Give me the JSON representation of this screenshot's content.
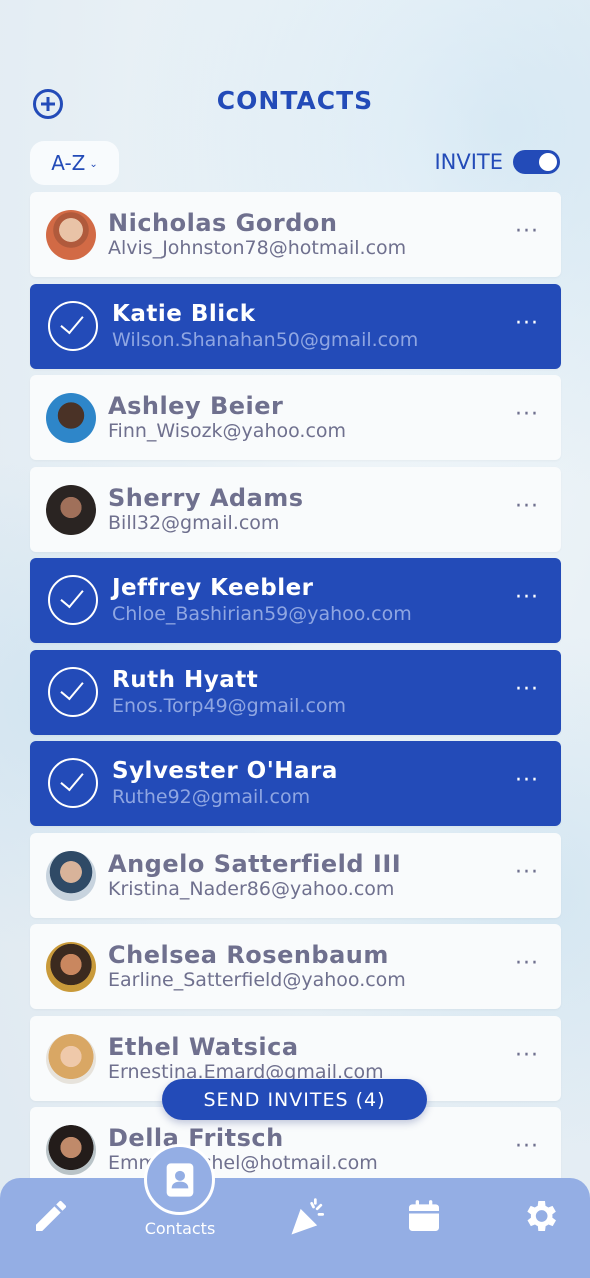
{
  "header": {
    "title": "CONTACTS",
    "add_icon": "add-circle-icon"
  },
  "controls": {
    "sort_label": "A-Z",
    "invite_label": "INVITE",
    "invite_toggle_on": true
  },
  "contacts": [
    {
      "name": "Nicholas Gordon",
      "email": "Alvis_Johnston78@hotmail.com",
      "selected": false
    },
    {
      "name": "Katie Blick",
      "email": "Wilson.Shanahan50@gmail.com",
      "selected": true
    },
    {
      "name": "Ashley Beier",
      "email": "Finn_Wisozk@yahoo.com",
      "selected": false
    },
    {
      "name": "Sherry Adams",
      "email": "Bill32@gmail.com",
      "selected": false
    },
    {
      "name": "Jeffrey Keebler",
      "email": "Chloe_Bashirian59@yahoo.com",
      "selected": true
    },
    {
      "name": "Ruth Hyatt",
      "email": "Enos.Torp49@gmail.com",
      "selected": true
    },
    {
      "name": "Sylvester O'Hara",
      "email": "Ruthe92@gmail.com",
      "selected": true
    },
    {
      "name": "Angelo Satterfield III",
      "email": "Kristina_Nader86@yahoo.com",
      "selected": false
    },
    {
      "name": "Chelsea Rosenbaum",
      "email": "Earline_Satterfield@yahoo.com",
      "selected": false
    },
    {
      "name": "Ethel Watsica",
      "email": "Ernestina.Emard@gmail.com",
      "selected": false
    },
    {
      "name": "Della Fritsch",
      "email": "Emmy.Reichel@hotmail.com",
      "selected": false
    }
  ],
  "send_button": {
    "label": "SEND INVITES (4)"
  },
  "tabbar": {
    "items": [
      {
        "icon": "pencil-icon"
      },
      {
        "icon": "contacts-icon",
        "label": "Contacts"
      },
      {
        "icon": "party-popper-icon"
      },
      {
        "icon": "calendar-icon"
      },
      {
        "icon": "gear-icon"
      }
    ]
  },
  "colors": {
    "accent": "#234bb8",
    "tabbar": "#94aee4",
    "text_muted": "#6f708e"
  }
}
